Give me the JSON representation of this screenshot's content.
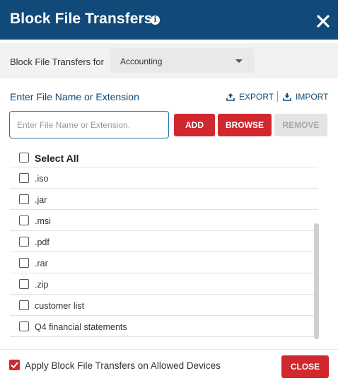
{
  "dialog": {
    "title": "Block File Transfers",
    "info_icon": "i",
    "close_icon": "close-icon"
  },
  "filter": {
    "label": "Block File Transfers for",
    "selected": "Accounting"
  },
  "entry": {
    "section_label": "Enter File Name or Extension",
    "export_label": "EXPORT",
    "import_label": "IMPORT",
    "placeholder": "Enter File Name or Extension.",
    "value": "",
    "add_label": "ADD",
    "browse_label": "BROWSE",
    "remove_label": "REMOVE"
  },
  "list": {
    "select_all_label": "Select All",
    "items": [
      {
        "label": ".iso",
        "checked": false
      },
      {
        "label": ".jar",
        "checked": false
      },
      {
        "label": ".msi",
        "checked": false
      },
      {
        "label": ".pdf",
        "checked": false
      },
      {
        "label": ".rar",
        "checked": false
      },
      {
        "label": ".zip",
        "checked": false
      },
      {
        "label": "customer list",
        "checked": false
      },
      {
        "label": "Q4 financial statements",
        "checked": false
      }
    ]
  },
  "footer": {
    "apply_label": "Apply Block File Transfers on Allowed Devices",
    "apply_checked": true,
    "close_label": "CLOSE"
  },
  "colors": {
    "header": "#114a78",
    "accent": "#d0282e",
    "link": "#114a78",
    "disabled": "#e4e4e4"
  }
}
